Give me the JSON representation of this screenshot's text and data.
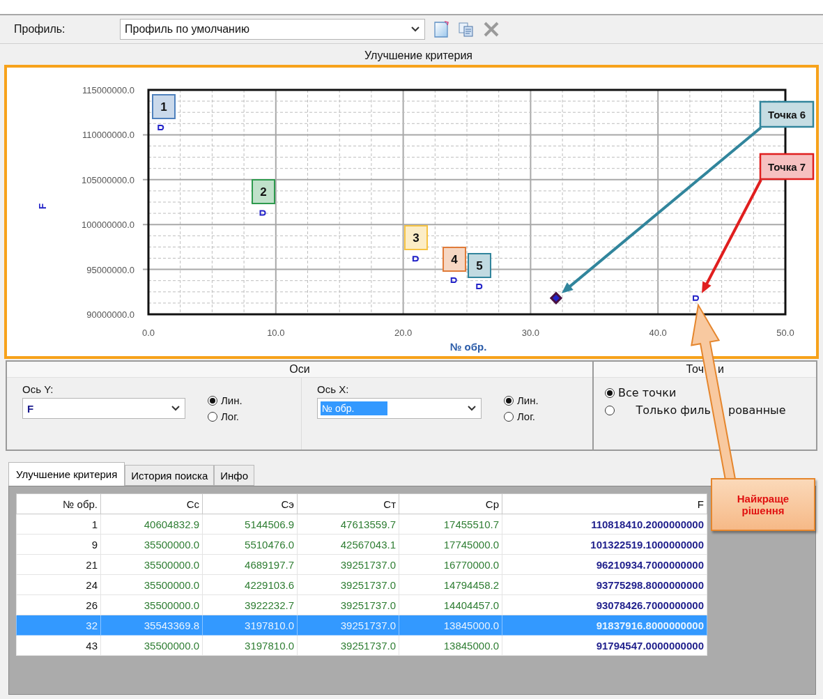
{
  "profile": {
    "label": "Профиль:",
    "value": "Профиль по умолчанию"
  },
  "section_title": "Улучшение критерия",
  "chart": {
    "chart_data": {
      "type": "scatter",
      "xlabel": "№ обр.",
      "ylabel": "F",
      "grid": true,
      "x": [
        1,
        9,
        21,
        24,
        26,
        32,
        43
      ],
      "series": [
        {
          "color": "#2323c8",
          "values": [
            110800000,
            101300000,
            96200000,
            93800000,
            93100000,
            91800000,
            91800000
          ]
        }
      ],
      "xlim": [
        0,
        50
      ],
      "ylim": [
        90000000,
        115000000
      ],
      "xticks": [
        {
          "value": 0,
          "label": "0.0"
        },
        {
          "value": 10,
          "label": "10.0"
        },
        {
          "value": 20,
          "label": "20.0"
        },
        {
          "value": 30,
          "label": "30.0"
        },
        {
          "value": 40,
          "label": "40.0"
        },
        {
          "value": 50,
          "label": "50.0"
        }
      ],
      "yticks": [
        {
          "value": 90000000,
          "label": "90000000.0"
        },
        {
          "value": 95000000,
          "label": "95000000.0"
        },
        {
          "value": 100000000,
          "label": "100000000.0"
        },
        {
          "value": 105000000,
          "label": "105000000.0"
        },
        {
          "value": 110000000,
          "label": "110000000.0"
        },
        {
          "value": 115000000,
          "label": "115000000.0"
        }
      ]
    },
    "point_labels": [
      {
        "kind": "box",
        "text": "1",
        "color": "#4f81bd"
      },
      {
        "kind": "box",
        "text": "2",
        "color": "#2e9a4e"
      },
      {
        "kind": "box",
        "text": "3",
        "color": "#f6c343"
      },
      {
        "kind": "box",
        "text": "4",
        "color": "#e07b39"
      },
      {
        "kind": "box",
        "text": "5",
        "color": "#31859c"
      },
      {
        "kind": "arrow",
        "text": "Точка 6",
        "color": "#31859c"
      },
      {
        "kind": "arrow",
        "text": "Точка 7",
        "color": "#e01e1e"
      }
    ]
  },
  "axes_panel": {
    "title": "Оси",
    "y_axis": {
      "label": "Ось Y:",
      "value": "F",
      "text_selected": false,
      "scale": [
        {
          "label": "Лин.",
          "selected": true
        },
        {
          "label": "Лог.",
          "selected": false
        }
      ]
    },
    "x_axis": {
      "label": "Ось X:",
      "value": "№ обр.",
      "text_selected": true,
      "scale": [
        {
          "label": "Лин.",
          "selected": true
        },
        {
          "label": "Лог.",
          "selected": false
        }
      ]
    }
  },
  "points_panel": {
    "title_parts": [
      "Точ",
      "и"
    ],
    "options": [
      {
        "label_parts": [
          "Все точки"
        ],
        "selected": true
      },
      {
        "label_parts": [
          "Только филь",
          "рованные"
        ],
        "selected": false
      }
    ]
  },
  "tabs": [
    {
      "label": "Улучшение критерия",
      "selected": true
    },
    {
      "label": "История поиска",
      "selected": false
    },
    {
      "label": "Инфо",
      "selected": false
    }
  ],
  "table": {
    "columns": [
      "№ обр.",
      "Сс",
      "Сэ",
      "Ст",
      "Ср",
      "F"
    ],
    "rows": [
      {
        "cells": [
          "1",
          "40604832.9",
          "5144506.9",
          "47613559.7",
          "17455510.7",
          "110818410.2000000000"
        ],
        "selected": false
      },
      {
        "cells": [
          "9",
          "35500000.0",
          "5510476.0",
          "42567043.1",
          "17745000.0",
          "101322519.1000000000"
        ],
        "selected": false
      },
      {
        "cells": [
          "21",
          "35500000.0",
          "4689197.7",
          "39251737.0",
          "16770000.0",
          "96210934.7000000000"
        ],
        "selected": false
      },
      {
        "cells": [
          "24",
          "35500000.0",
          "4229103.6",
          "39251737.0",
          "14794458.2",
          "93775298.8000000000"
        ],
        "selected": false
      },
      {
        "cells": [
          "26",
          "35500000.0",
          "3922232.7",
          "39251737.0",
          "14404457.0",
          "93078426.7000000000"
        ],
        "selected": false
      },
      {
        "cells": [
          "32",
          "35543369.8",
          "3197810.0",
          "39251737.0",
          "13845000.0",
          "91837916.8000000000"
        ],
        "selected": true
      },
      {
        "cells": [
          "43",
          "35500000.0",
          "3197810.0",
          "39251737.0",
          "13845000.0",
          "91794547.0000000000"
        ],
        "selected": false
      }
    ]
  },
  "callout": {
    "text": "Найкраще рішення"
  }
}
